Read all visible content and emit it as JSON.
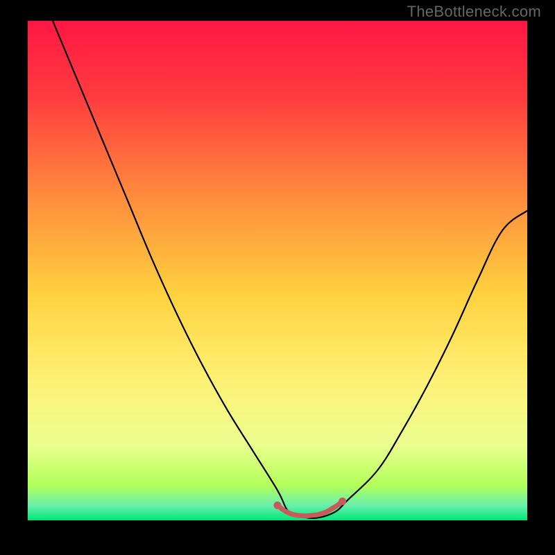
{
  "watermark": "TheBottleneck.com",
  "chart_data": {
    "type": "line",
    "title": "",
    "xlabel": "",
    "ylabel": "",
    "xlim": [
      0,
      100
    ],
    "ylim": [
      0,
      100
    ],
    "series": [
      {
        "name": "bottleneck-curve",
        "x": [
          5,
          10,
          15,
          20,
          25,
          30,
          35,
          40,
          45,
          50,
          52,
          54,
          56,
          58,
          60,
          62,
          64,
          70,
          75,
          80,
          85,
          90,
          95,
          100
        ],
        "y": [
          100,
          88,
          76,
          64,
          52,
          41,
          31,
          22,
          14,
          6,
          2,
          1,
          0.5,
          0.5,
          1,
          2,
          4,
          10,
          18,
          27,
          37,
          48,
          58,
          62
        ]
      },
      {
        "name": "optimal-marker",
        "x": [
          50,
          51,
          52,
          53,
          54,
          55,
          56,
          57,
          58,
          59,
          60,
          61,
          62,
          63
        ],
        "y": [
          3,
          2.2,
          1.6,
          1.2,
          1.0,
          0.9,
          0.9,
          1.0,
          1.1,
          1.4,
          1.8,
          2.4,
          3.0,
          3.8
        ]
      }
    ],
    "gradient_stops": [
      {
        "pos": 0.0,
        "color": "#ff1744"
      },
      {
        "pos": 0.15,
        "color": "#ff3b3f"
      },
      {
        "pos": 0.35,
        "color": "#ff8b3d"
      },
      {
        "pos": 0.55,
        "color": "#ffd23f"
      },
      {
        "pos": 0.72,
        "color": "#fff176"
      },
      {
        "pos": 0.85,
        "color": "#eaff8f"
      },
      {
        "pos": 0.93,
        "color": "#b2ff59"
      },
      {
        "pos": 0.97,
        "color": "#69f0ae"
      },
      {
        "pos": 1.0,
        "color": "#00e676"
      }
    ]
  }
}
